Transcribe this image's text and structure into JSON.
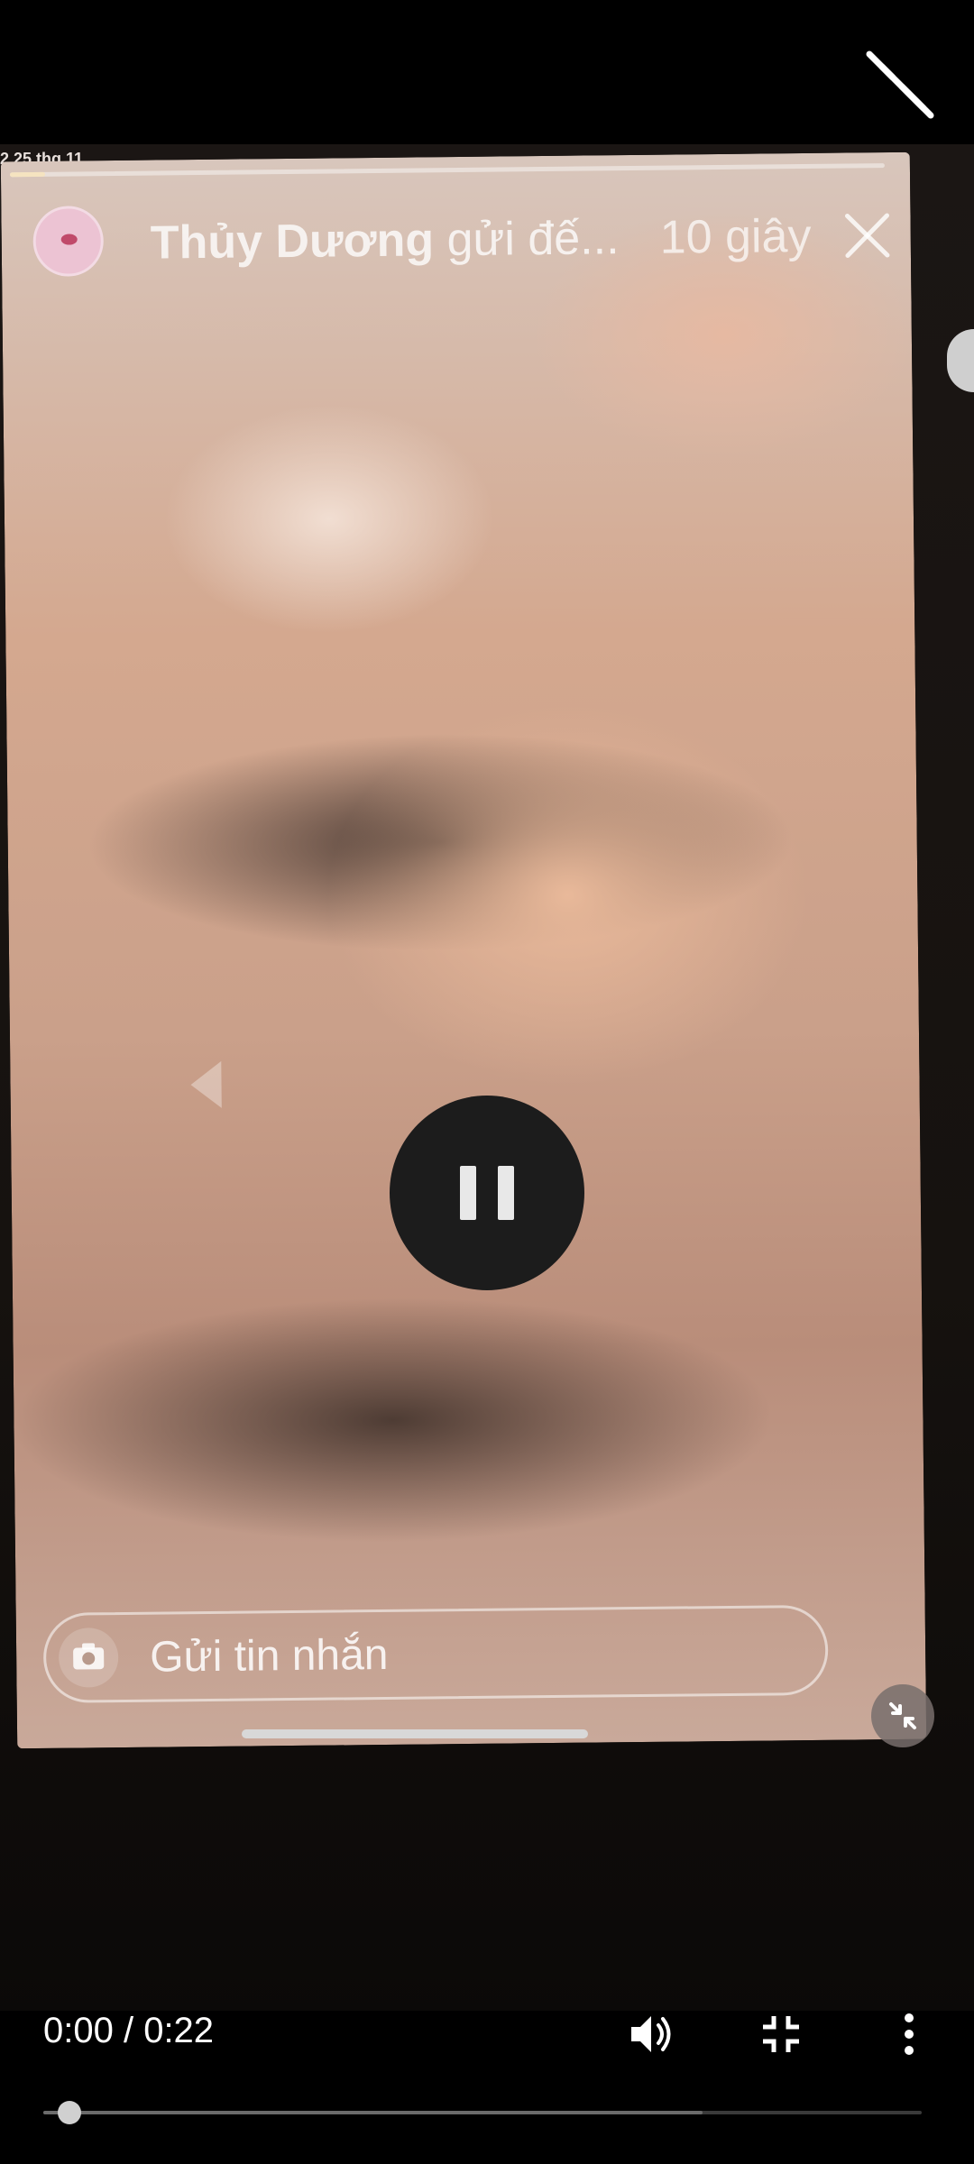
{
  "top_bar": {
    "collapse_icon": "collapse-diagonal-icon"
  },
  "recording": {
    "status_text": "2 25 thg 11"
  },
  "story": {
    "progress": 0.04,
    "sender_name": "Thủy Dương",
    "sender_suffix": " gửi đế...",
    "elapsed": "10 giây",
    "close_icon": "close-icon",
    "message_placeholder": "Gửi tin nhắn",
    "camera_icon": "camera-icon"
  },
  "player": {
    "state_icon": "pause-icon",
    "time": "0:00 / 0:22",
    "progress": 0.03,
    "buffered": 0.75,
    "volume_icon": "volume-icon",
    "fullscreen_icon": "exit-fullscreen-icon",
    "more_icon": "more-vertical-icon",
    "minimize_icon": "minimize-icon"
  }
}
